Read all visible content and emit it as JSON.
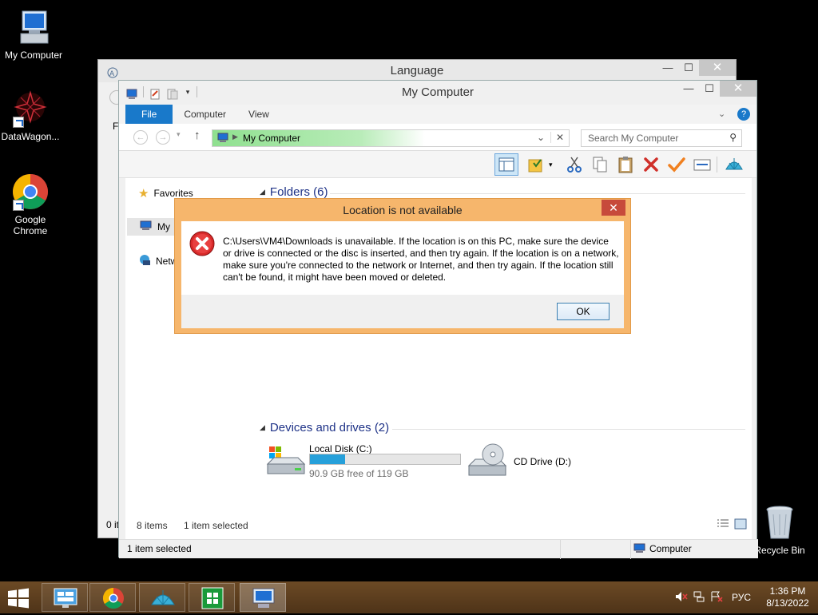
{
  "desktop": {
    "icons": [
      {
        "label": "My Computer"
      },
      {
        "label": "DataWagon..."
      },
      {
        "label": "Google Chrome"
      },
      {
        "label": "Recycle Bin"
      }
    ]
  },
  "language_window": {
    "title": "Language",
    "left_fragment_1": "Fi",
    "left_fragment_2": "0 it"
  },
  "explorer": {
    "title": "My Computer",
    "tabs": [
      "File",
      "Computer",
      "View"
    ],
    "address": "My Computer",
    "search_placeholder": "Search My Computer",
    "nav": {
      "favorites": "Favorites",
      "my_computer": "My",
      "network": "Netw"
    },
    "folders_header": "Folders (6)",
    "devices_header": "Devices and drives (2)",
    "drives": [
      {
        "name": "Local Disk (C:)",
        "free": "90.9 GB free of 119 GB",
        "used_fraction": 0.236
      },
      {
        "name": "CD Drive (D:)"
      }
    ],
    "status": {
      "items": "8 items",
      "selected": "1 item selected"
    },
    "bottom_status": {
      "selected": "1 item selected",
      "location": "Computer"
    }
  },
  "dialog": {
    "title": "Location is not available",
    "message": "C:\\Users\\VM4\\Downloads is unavailable. If the location is on this PC, make sure the device or drive is connected or the disc is inserted, and then try again. If the location is on a network, make sure you're connected to the network or Internet, and then try again. If the location still can't be found, it might have been moved or deleted.",
    "ok_label": "OK",
    "close_glyph": "✕"
  },
  "taskbar": {
    "language": "РУС",
    "time": "1:36 PM",
    "date": "8/13/2022"
  },
  "colors": {
    "ribbon_file": "#1979ca",
    "dialog_frame": "#f6b66c",
    "drive_bar": "#26a0da",
    "taskbar": "#5b3d1e"
  }
}
